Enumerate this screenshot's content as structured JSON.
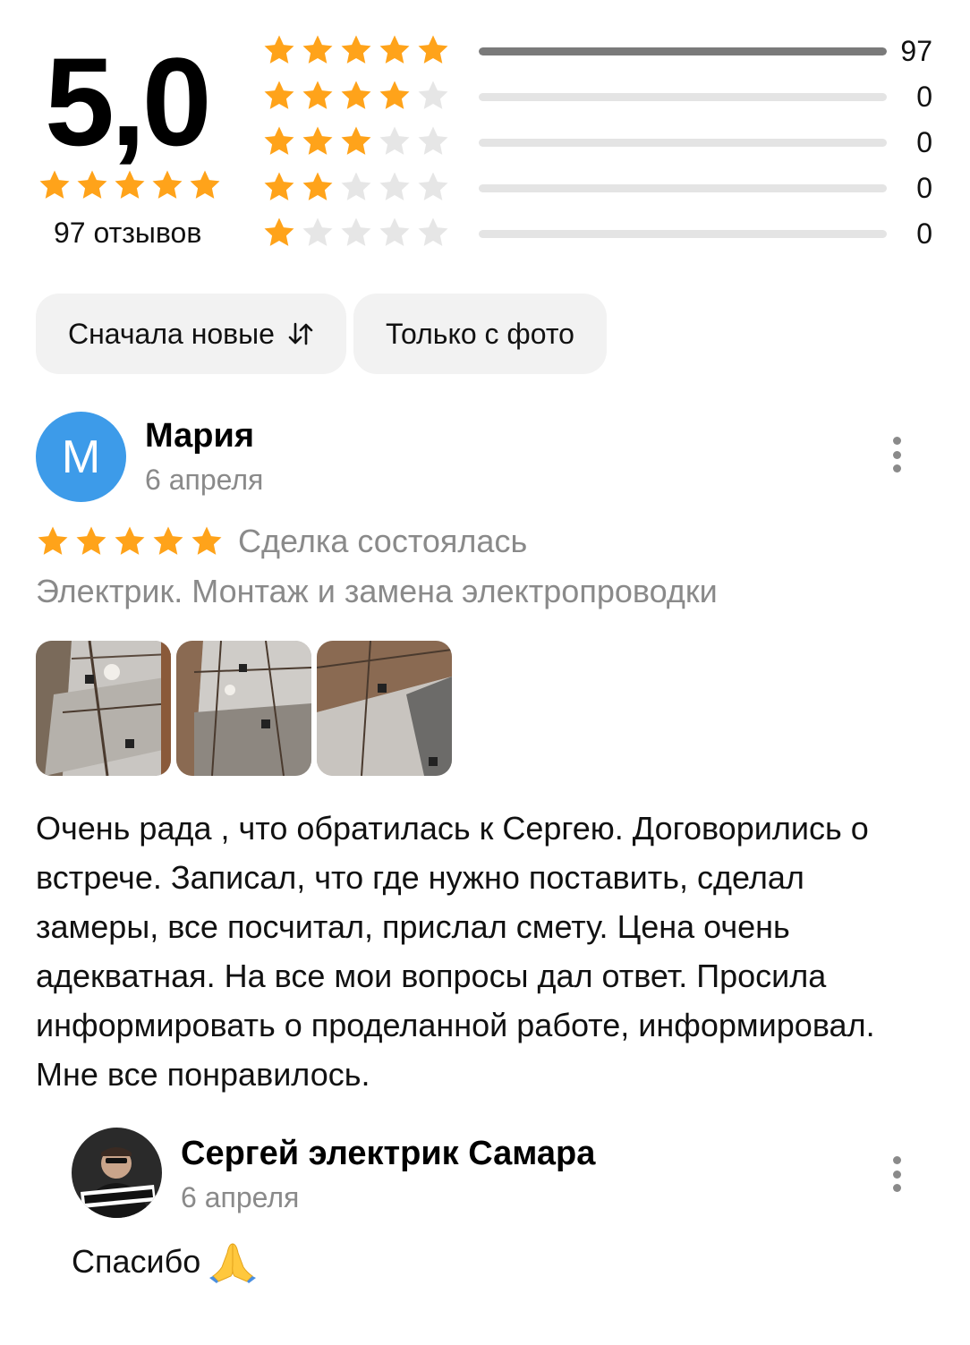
{
  "summary": {
    "rating": "5,0",
    "rating_stars": 5,
    "reviews_count_label": "97 отзывов",
    "distribution": [
      {
        "stars": 5,
        "count": "97",
        "fraction": 1.0
      },
      {
        "stars": 4,
        "count": "0",
        "fraction": 0
      },
      {
        "stars": 3,
        "count": "0",
        "fraction": 0
      },
      {
        "stars": 2,
        "count": "0",
        "fraction": 0
      },
      {
        "stars": 1,
        "count": "0",
        "fraction": 0
      }
    ]
  },
  "filters": {
    "sort_label": "Сначала новые",
    "sort_icon": "sort-arrows-icon",
    "photo_only_label": "Только с фото"
  },
  "review": {
    "avatar_letter": "М",
    "avatar_color": "#3d9be9",
    "author": "Мария",
    "date": "6 апреля",
    "stars": 5,
    "deal_status": "Сделка состоялась",
    "service": "Электрик. Монтаж и замена электропроводки",
    "photos": [
      "photo-ceiling-wiring-1",
      "photo-ceiling-wiring-2",
      "photo-ceiling-wiring-3"
    ],
    "text": "Очень рада , что обратилась к Сергею. Договорились о встрече. Записал, что где нужно поставить, сделал замеры, все посчитал, прислал смету. Цена очень адекватная. На все мои вопросы дал ответ. Просила информировать о проделанной работе, информировал. Мне все понравилось."
  },
  "reply": {
    "author": "Сергей электрик Самара",
    "date": "6 апреля",
    "text": "Спасибо",
    "emoji_icon": "folded-hands-icon",
    "avatar_logo_text": "КАЧЕСТВЕННАЯ ЭЛЕКТРИКА"
  },
  "colors": {
    "star_on": "#ffa31a",
    "star_off": "#e6e6e6",
    "secondary_text": "#8a8a8a",
    "chip_bg": "#f2f2f2"
  }
}
